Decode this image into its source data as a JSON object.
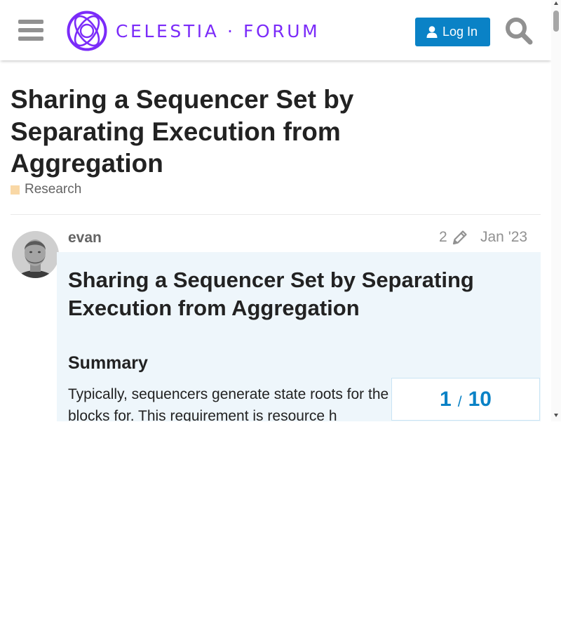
{
  "header": {
    "logo_text": "CELESTIA · FORUM",
    "login_label": "Log In",
    "icons": {
      "menu": "hamburger-menu-icon",
      "user": "user-icon",
      "search": "search-icon",
      "logo": "celestia-logo-mark"
    }
  },
  "topic": {
    "title": "Sharing a Sequencer Set by Separating Execution from Aggregation",
    "category": "Research",
    "category_color": "#f9d8a6"
  },
  "post": {
    "username": "evan",
    "edit_count": "2",
    "date": "Jan '23",
    "heading": "Sharing a Sequencer Set by Separating Execution from Aggregation",
    "subheading": "Summary",
    "paragraph": "Typically, sequencers generate state roots for the rollups they create blocks for. This requirement is resource h"
  },
  "progress": {
    "current": "1",
    "separator": "/",
    "total": "10"
  },
  "colors": {
    "accent": "#0a82c6",
    "brand": "#7b2bf9",
    "post_bg": "#eef6fb"
  }
}
